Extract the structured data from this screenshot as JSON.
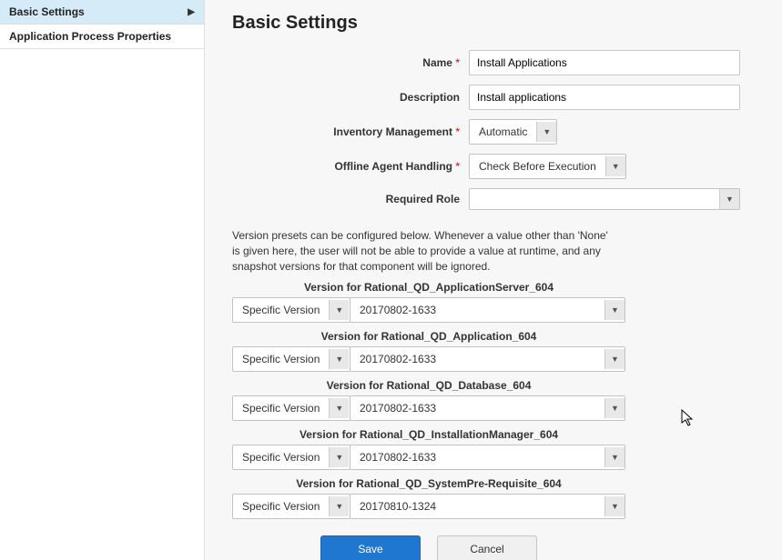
{
  "sidebar": {
    "items": [
      {
        "label": "Basic Settings"
      },
      {
        "label": "Application Process Properties"
      }
    ]
  },
  "page": {
    "title": "Basic Settings"
  },
  "form": {
    "name_label": "Name",
    "name_value": "Install Applications",
    "desc_label": "Description",
    "desc_value": "Install applications",
    "inv_label": "Inventory Management",
    "inv_value": "Automatic",
    "offline_label": "Offline Agent Handling",
    "offline_value": "Check Before Execution",
    "role_label": "Required Role",
    "role_value": ""
  },
  "presets_note": "Version presets can be configured below. Whenever a value other than 'None' is given here, the user will not be able to provide a value at runtime, and any snapshot versions for that component will be ignored.",
  "versions": [
    {
      "label": "Version for Rational_QD_ApplicationServer_604",
      "type": "Specific Version",
      "value": "20170802-1633"
    },
    {
      "label": "Version for Rational_QD_Application_604",
      "type": "Specific Version",
      "value": "20170802-1633"
    },
    {
      "label": "Version for Rational_QD_Database_604",
      "type": "Specific Version",
      "value": "20170802-1633"
    },
    {
      "label": "Version for Rational_QD_InstallationManager_604",
      "type": "Specific Version",
      "value": "20170802-1633"
    },
    {
      "label": "Version for Rational_QD_SystemPre-Requisite_604",
      "type": "Specific Version",
      "value": "20170810-1324"
    }
  ],
  "buttons": {
    "save": "Save",
    "cancel": "Cancel"
  },
  "req": "*"
}
